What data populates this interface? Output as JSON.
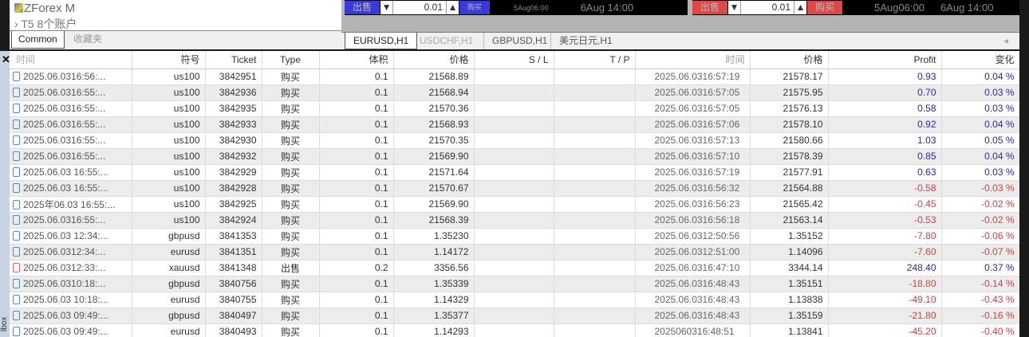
{
  "navigator": {
    "brand": "ZForex M",
    "accounts": "T5 8个账户",
    "tabs": [
      "Common",
      "收藏夹"
    ]
  },
  "charts": [
    {
      "sell": "出售",
      "buy": "购买",
      "lot": "0.01",
      "times": [
        "5Aug06:00",
        "6Aug 14:00"
      ],
      "color": "#3a3ad8"
    },
    {
      "sell": "出售",
      "buy": "购买",
      "lot": "0.01",
      "times": [
        "5Aug06:00",
        "6Aug 14:00"
      ],
      "color": "#e04848"
    }
  ],
  "chart_tabs": [
    "EURUSD,H1",
    "USDCHF,H1",
    "GBPUSD,H1",
    "美元日元,H1"
  ],
  "toolbox_label": "lbox",
  "columns": [
    "时间",
    "符号",
    "Ticket",
    "Type",
    "体积",
    "价格",
    "S / L",
    "T / P",
    "时间",
    "价格",
    "Profit",
    "变化"
  ],
  "rows": [
    [
      "2025.06.0316:56:...",
      "us100",
      "3842951",
      "购买",
      "0.1",
      "21568.89",
      "",
      "",
      "2025.06.0316:57:19",
      "21578.17",
      "0.93",
      "0.04 %"
    ],
    [
      "2025.06.0316:55:...",
      "us100",
      "3842936",
      "购买",
      "0.1",
      "21568.94",
      "",
      "",
      "2025.06.0316:57:05",
      "21575.95",
      "0.70",
      "0.03 %"
    ],
    [
      "2025.06.0316:55:...",
      "us100",
      "3842935",
      "购买",
      "0.1",
      "21570.36",
      "",
      "",
      "2025.06.0316:57:05",
      "21576.13",
      "0.58",
      "0.03 %"
    ],
    [
      "2025.06.0316:55:...",
      "us100",
      "3842933",
      "购买",
      "0.1",
      "21568.93",
      "",
      "",
      "2025.06.0316:57:06",
      "21578.10",
      "0.92",
      "0.04 %"
    ],
    [
      "2025.06.0316:55:...",
      "us100",
      "3842930",
      "购买",
      "0.1",
      "21570.35",
      "",
      "",
      "2025.06.0316:57:13",
      "21580.66",
      "1.03",
      "0.05 %"
    ],
    [
      "2025.06.0316:55:...",
      "us100",
      "3842932",
      "购买",
      "0.1",
      "21569.90",
      "",
      "",
      "2025.06.0316:57:10",
      "21578.39",
      "0.85",
      "0.04 %"
    ],
    [
      "2025.06.03 16:55:...",
      "us100",
      "3842929",
      "购买",
      "0.1",
      "21571.64",
      "",
      "",
      "2025.06.0316:57:19",
      "21577.91",
      "0.63",
      "0.03 %"
    ],
    [
      "2025.06.03 16:55:...",
      "us100",
      "3842928",
      "购买",
      "0.1",
      "21570.67",
      "",
      "",
      "2025.06.0316:56:32",
      "21564.88",
      "-0.58",
      "-0.03 %"
    ],
    [
      "2025年06.03 16:55:...",
      "us100",
      "3842925",
      "购买",
      "0.1",
      "21569.90",
      "",
      "",
      "2025.06.0316:56:23",
      "21565.42",
      "-0.45",
      "-0.02 %"
    ],
    [
      "2025.06.0316:55:...",
      "us100",
      "3842924",
      "购买",
      "0.1",
      "21568.39",
      "",
      "",
      "2025.06.0316:56:18",
      "21563.14",
      "-0.53",
      "-0.02 %"
    ],
    [
      "2025.06.03 12:34:...",
      "gbpusd",
      "3841353",
      "购买",
      "0.1",
      "1.35230",
      "",
      "",
      "2025.06.0312:50:56",
      "1.35152",
      "-7.80",
      "-0.06 %"
    ],
    [
      "2025.06.0312:34:...",
      "eurusd",
      "3841351",
      "购买",
      "0.1",
      "1.14172",
      "",
      "",
      "2025.06.0312:51:00",
      "1.14096",
      "-7.60",
      "-0.07 %"
    ],
    [
      "2025.06.0312:33:...",
      "xauusd",
      "3841348",
      "出售",
      "0.2",
      "3356.56",
      "",
      "",
      "2025.06.0316:47:10",
      "3344.14",
      "248.40",
      "0.37 %"
    ],
    [
      "2025.06.0310:18:...",
      "gbpusd",
      "3840756",
      "购买",
      "0.1",
      "1.35339",
      "",
      "",
      "2025.06.0316:48:43",
      "1.35151",
      "-18.80",
      "-0.14 %"
    ],
    [
      "2025.06.03 10:18:...",
      "eurusd",
      "3840755",
      "购买",
      "0.1",
      "1.14329",
      "",
      "",
      "2025.06.0316:48:43",
      "1.13838",
      "-49.10",
      "-0.43 %"
    ],
    [
      "2025.06.03 09:49:...",
      "gbpusd",
      "3840497",
      "购买",
      "0.1",
      "1.35377",
      "",
      "",
      "2025.06.0316:48:43",
      "1.35159",
      "-21.80",
      "-0.16 %"
    ],
    [
      "2025.06.03 09:49:...",
      "eurusd",
      "3840493",
      "购买",
      "0.1",
      "1.14293",
      "",
      "",
      "2025060316:48:51",
      "1.13841",
      "-45.20",
      "-0.40 %"
    ]
  ]
}
